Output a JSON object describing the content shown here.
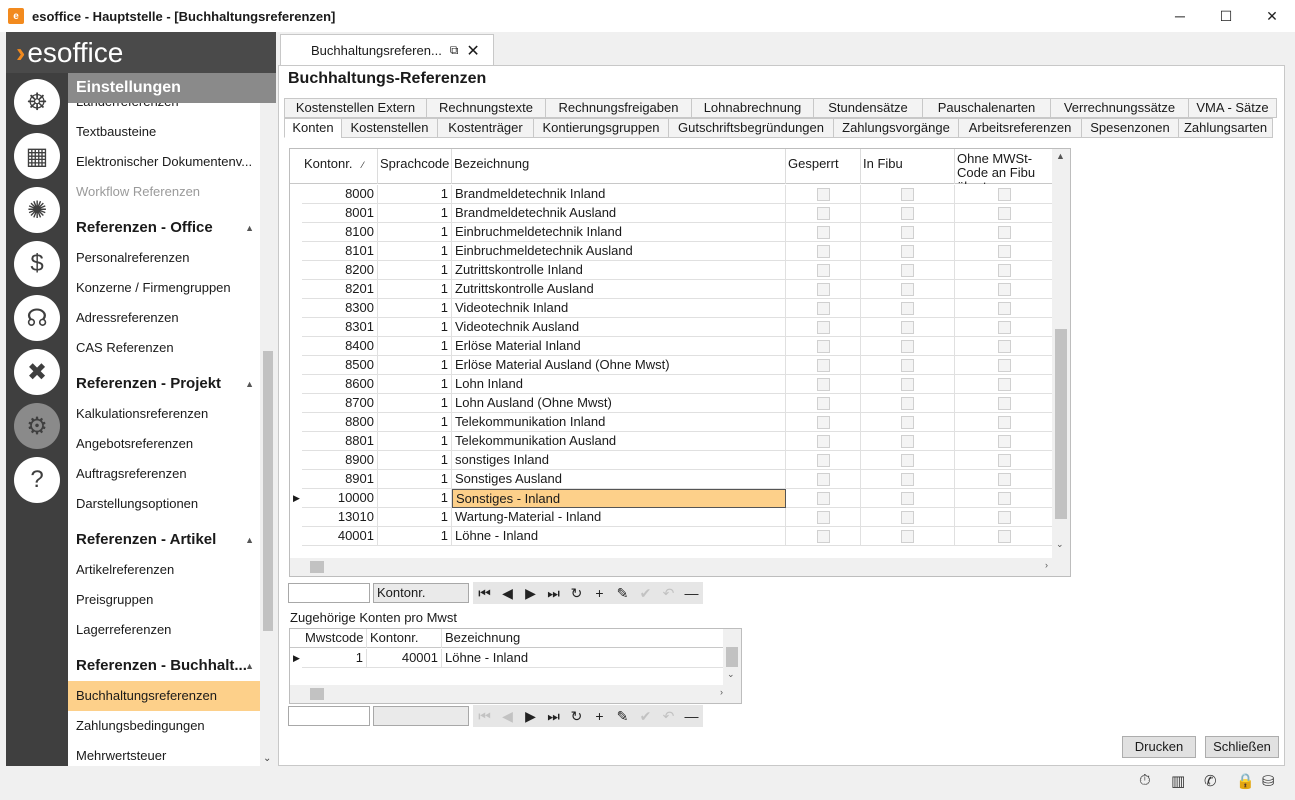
{
  "window": {
    "title": "esoffice - Hauptstelle - [Buchhaltungsreferenzen]",
    "app_icon": "esoffice-app-icon",
    "minimize": "─",
    "maximize": "☐",
    "close": "✕"
  },
  "logo": {
    "chevron": "›",
    "text": "esoffice"
  },
  "rail": {
    "icons": [
      "ship-wheel-icon",
      "abacus-icon",
      "alarm-light-icon",
      "money-icon",
      "headset-icon",
      "tools-icon",
      "gears-icon",
      "help-icon"
    ],
    "glyphs": [
      "☸",
      "▦",
      "✺",
      "$",
      "☊",
      "✖",
      "⚙",
      "?"
    ]
  },
  "nav": {
    "header": "Einstellungen",
    "items_top": [
      {
        "label": "Länderreferenzen",
        "state": "partial"
      },
      {
        "label": "Textbausteine"
      },
      {
        "label": "Elektronischer Dokumentenv..."
      },
      {
        "label": "Workflow Referenzen",
        "state": "disabled"
      }
    ],
    "groups": [
      {
        "title": "Referenzen - Office",
        "items": [
          "Personalreferenzen",
          "Konzerne / Firmengruppen",
          "Adressreferenzen",
          "CAS Referenzen"
        ]
      },
      {
        "title": "Referenzen - Projekt",
        "items": [
          "Kalkulationsreferenzen",
          "Angebotsreferenzen",
          "Auftragsreferenzen",
          "Darstellungsoptionen"
        ]
      },
      {
        "title": "Referenzen - Artikel",
        "items": [
          "Artikelreferenzen",
          "Preisgruppen",
          "Lagerreferenzen"
        ]
      },
      {
        "title": "Referenzen - Buchhalt...",
        "items": [
          "Buchhaltungsreferenzen",
          "Zahlungsbedingungen",
          "Mehrwertsteuer"
        ]
      }
    ],
    "selected": "Buchhaltungsreferenzen",
    "group_arrow": "▲",
    "scroll_down": "⌄"
  },
  "doc_tab": {
    "label": "Buchhaltungsreferen...",
    "popout": "⧉",
    "close": "✕"
  },
  "page": {
    "title": "Buchhaltungs-Referenzen"
  },
  "tabs_row1": [
    {
      "label": "Kostenstellen Extern",
      "w": 142
    },
    {
      "label": "Rechnungstexte",
      "w": 119
    },
    {
      "label": "Rechnungsfreigaben",
      "w": 146
    },
    {
      "label": "Lohnabrechnung",
      "w": 122
    },
    {
      "label": "Stundensätze",
      "w": 109
    },
    {
      "label": "Pauschalenarten",
      "w": 128
    },
    {
      "label": "Verrechnungssätze",
      "w": 138
    },
    {
      "label": "VMA - Sätze",
      "w": 89
    }
  ],
  "tabs_row2": [
    {
      "label": "Konten",
      "w": 57,
      "active": true
    },
    {
      "label": "Kostenstellen",
      "w": 96
    },
    {
      "label": "Kostenträger",
      "w": 96
    },
    {
      "label": "Kontierungsgruppen",
      "w": 135
    },
    {
      "label": "Gutschriftsbegründungen",
      "w": 165
    },
    {
      "label": "Zahlungsvorgänge",
      "w": 125
    },
    {
      "label": "Arbeitsreferenzen",
      "w": 123
    },
    {
      "label": "Spesenzonen",
      "w": 97
    },
    {
      "label": "Zahlungsarten",
      "w": 95
    }
  ],
  "grid": {
    "columns": {
      "kontonr": "Kontonr.",
      "sort": "⁄",
      "sprachcode": "Sprachcode",
      "bezeichnung": "Bezeichnung",
      "gesperrt": "Gesperrt",
      "fibu": "In Fibu Gebucht",
      "mwst": "Ohne MWSt-Code an Fibu übertragen"
    },
    "current_row_marker": "▶",
    "rows": [
      {
        "kontonr": "8000",
        "sprachcode": "1",
        "bezeichnung": "Brandmeldetechnik Inland"
      },
      {
        "kontonr": "8001",
        "sprachcode": "1",
        "bezeichnung": "Brandmeldetechnik Ausland"
      },
      {
        "kontonr": "8100",
        "sprachcode": "1",
        "bezeichnung": "Einbruchmeldetechnik Inland"
      },
      {
        "kontonr": "8101",
        "sprachcode": "1",
        "bezeichnung": "Einbruchmeldetechnik Ausland"
      },
      {
        "kontonr": "8200",
        "sprachcode": "1",
        "bezeichnung": "Zutrittskontrolle Inland"
      },
      {
        "kontonr": "8201",
        "sprachcode": "1",
        "bezeichnung": "Zutrittskontrolle Ausland"
      },
      {
        "kontonr": "8300",
        "sprachcode": "1",
        "bezeichnung": "Videotechnik Inland"
      },
      {
        "kontonr": "8301",
        "sprachcode": "1",
        "bezeichnung": "Videotechnik Ausland"
      },
      {
        "kontonr": "8400",
        "sprachcode": "1",
        "bezeichnung": "Erlöse Material Inland"
      },
      {
        "kontonr": "8500",
        "sprachcode": "1",
        "bezeichnung": "Erlöse Material Ausland (Ohne Mwst)"
      },
      {
        "kontonr": "8600",
        "sprachcode": "1",
        "bezeichnung": "Lohn Inland"
      },
      {
        "kontonr": "8700",
        "sprachcode": "1",
        "bezeichnung": "Lohn Ausland (Ohne Mwst)"
      },
      {
        "kontonr": "8800",
        "sprachcode": "1",
        "bezeichnung": "Telekommunikation Inland"
      },
      {
        "kontonr": "8801",
        "sprachcode": "1",
        "bezeichnung": "Telekommunikation Ausland"
      },
      {
        "kontonr": "8900",
        "sprachcode": "1",
        "bezeichnung": "sonstiges Inland"
      },
      {
        "kontonr": "8901",
        "sprachcode": "1",
        "bezeichnung": "Sonstiges Ausland"
      },
      {
        "kontonr": "10000",
        "sprachcode": "1",
        "bezeichnung": "Sonstiges - Inland",
        "current": true
      },
      {
        "kontonr": "13010",
        "sprachcode": "1",
        "bezeichnung": "Wartung-Material - Inland"
      },
      {
        "kontonr": "40001",
        "sprachcode": "1",
        "bezeichnung": "Löhne - Inland"
      }
    ],
    "scroll_up": "▲",
    "scroll_down": "⌄",
    "scroll_right": "›"
  },
  "navigator1": {
    "search_value": "",
    "field": "Kontonr."
  },
  "navigator2": {
    "search_value": "",
    "field": ""
  },
  "nav_glyphs": {
    "first": "⏮",
    "prev": "◀",
    "next": "▶",
    "last": "⏭",
    "refresh": "↻",
    "add": "+",
    "edit": "✎",
    "confirm": "✔",
    "undo": "↶",
    "delete": "—"
  },
  "sub": {
    "label": "Zugehörige Konten pro Mwst",
    "columns": {
      "mwstcode": "Mwstcode",
      "kontonr": "Kontonr.",
      "bezeichnung": "Bezeichnung"
    },
    "rows": [
      {
        "mwstcode": "1",
        "kontonr": "40001",
        "bezeichnung": "Löhne - Inland"
      }
    ]
  },
  "buttons": {
    "print": "Drucken",
    "close": "Schließen"
  },
  "status": {
    "icons": [
      "stopwatch-icon",
      "building-icon",
      "phone-icon",
      "lock-icon",
      "database-icon"
    ],
    "glyphs": [
      "⏱",
      "▥",
      "✆",
      "🔒",
      "⛁"
    ]
  },
  "colors": {
    "accent": "#f28a1e",
    "selection": "#fdd08a",
    "rail": "#4a4a4a"
  }
}
